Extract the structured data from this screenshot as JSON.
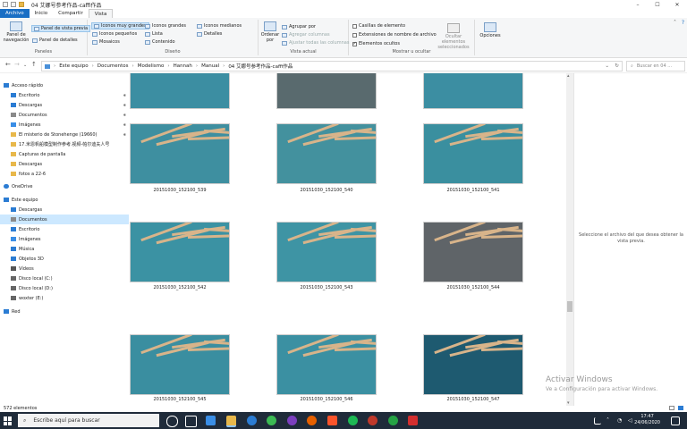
{
  "window": {
    "title": "04 艾娜号参考作品-caffi作品",
    "controls": [
      "–",
      "☐",
      "✕"
    ]
  },
  "tabs": [
    "Archivo",
    "Inicio",
    "Compartir",
    "Vista"
  ],
  "ribbon": {
    "panes": {
      "nav_pane": "Panel de navegación",
      "preview_pane": "Panel de vista previa",
      "details_pane": "Panel de detalles",
      "label": "Paneles"
    },
    "layout": {
      "xl_icons": "Iconos muy grandes",
      "large_icons": "Iconos grandes",
      "medium_icons": "Iconos medianos",
      "small_icons": "Iconos pequeños",
      "list": "Lista",
      "details": "Detalles",
      "tiles": "Mosaicos",
      "content": "Contenido",
      "label": "Diseño"
    },
    "current_view": {
      "sort_by": "Ordenar por",
      "group_by": "Agrupar por",
      "add_columns": "Agregar columnas",
      "fit_columns": "Ajustar todas las columnas",
      "label": "Vista actual"
    },
    "show_hide": {
      "item_checkboxes": "Casillas de elemento",
      "file_extensions": "Extensiones de nombre de archivo",
      "hidden_items": "Elementos ocultos",
      "hide_selected": "Ocultar elementos seleccionados",
      "label": "Mostrar u ocultar"
    },
    "options": "Opciones"
  },
  "address": {
    "crumbs": [
      "Este equipo",
      "Documentos",
      "Modelismo",
      "Hannah",
      "Manual",
      "04 艾娜号参考作品-caffi作品"
    ]
  },
  "search": {
    "placeholder": "Buscar en 04 ..."
  },
  "sidebar": {
    "items": [
      {
        "label": "Acceso rápido",
        "color": "#2b7cd3"
      },
      {
        "label": "Escritorio",
        "color": "#2b7cd3"
      },
      {
        "label": "Descargas",
        "color": "#2b7cd3"
      },
      {
        "label": "Documentos",
        "color": "#8a8a8a"
      },
      {
        "label": "Imágenes",
        "color": "#3a8ee6"
      },
      {
        "label": "El misterio de Stonehenge (19660)",
        "color": "#e8b84b"
      },
      {
        "label": "17.米恩帆船模型制作参考.视频-帕尔迪夫人号",
        "color": "#e8b84b"
      },
      {
        "label": "Capturas de pantalla",
        "color": "#e8b84b"
      },
      {
        "label": "Descargas",
        "color": "#e8b84b"
      },
      {
        "label": "fotos a 22-6",
        "color": "#e8b84b"
      },
      {
        "label": "OneDrive",
        "color": "#2b7cd3"
      },
      {
        "label": "Este equipo",
        "color": "#2b7cd3"
      },
      {
        "label": "Descargas",
        "color": "#2b7cd3"
      },
      {
        "label": "Documentos",
        "color": "#8a8a8a"
      },
      {
        "label": "Escritorio",
        "color": "#2b7cd3"
      },
      {
        "label": "Imágenes",
        "color": "#3a8ee6"
      },
      {
        "label": "Música",
        "color": "#2b7cd3"
      },
      {
        "label": "Objetos 3D",
        "color": "#2b7cd3"
      },
      {
        "label": "Vídeos",
        "color": "#555555"
      },
      {
        "label": "Disco local (C:)",
        "color": "#666666"
      },
      {
        "label": "Disco local (D:)",
        "color": "#666666"
      },
      {
        "label": "woxter (E:)",
        "color": "#666666"
      },
      {
        "label": "Red",
        "color": "#2b7cd3"
      }
    ]
  },
  "files": [
    {
      "name": "",
      "bg": "#3c8ea2"
    },
    {
      "name": "",
      "bg": "#596a6e"
    },
    {
      "name": "",
      "bg": "#3c8ea2"
    },
    {
      "name": "20151030_152100_539",
      "bg": "#3e8fa0"
    },
    {
      "name": "20151030_152100_540",
      "bg": "#43919e"
    },
    {
      "name": "20151030_152100_541",
      "bg": "#3a8f9f"
    },
    {
      "name": "20151030_152100_542",
      "bg": "#3b92a3"
    },
    {
      "name": "20151030_152100_543",
      "bg": "#3e94a4"
    },
    {
      "name": "20151030_152100_544",
      "bg": "#5f6468"
    },
    {
      "name": "20151030_152100_545",
      "bg": "#3c90a2"
    },
    {
      "name": "20151030_152100_546",
      "bg": "#3d92a4"
    },
    {
      "name": "20151030_152100_547",
      "bg": "#3a8f9f"
    },
    {
      "name": "",
      "bg": "#3a8ea0"
    },
    {
      "name": "",
      "bg": "#3b90a2"
    },
    {
      "name": "",
      "bg": "#1e5a70"
    }
  ],
  "preview": {
    "message": "Seleccione el archivo del que desea obtener la vista previa."
  },
  "status": {
    "count": "572 elementos"
  },
  "activation": {
    "line1": "Activar Windows",
    "line2": "Ve a Configuración para activar Windows."
  },
  "taskbar": {
    "search_placeholder": "Escribe aquí para buscar",
    "time": "17:47",
    "date": "24/06/2020"
  }
}
